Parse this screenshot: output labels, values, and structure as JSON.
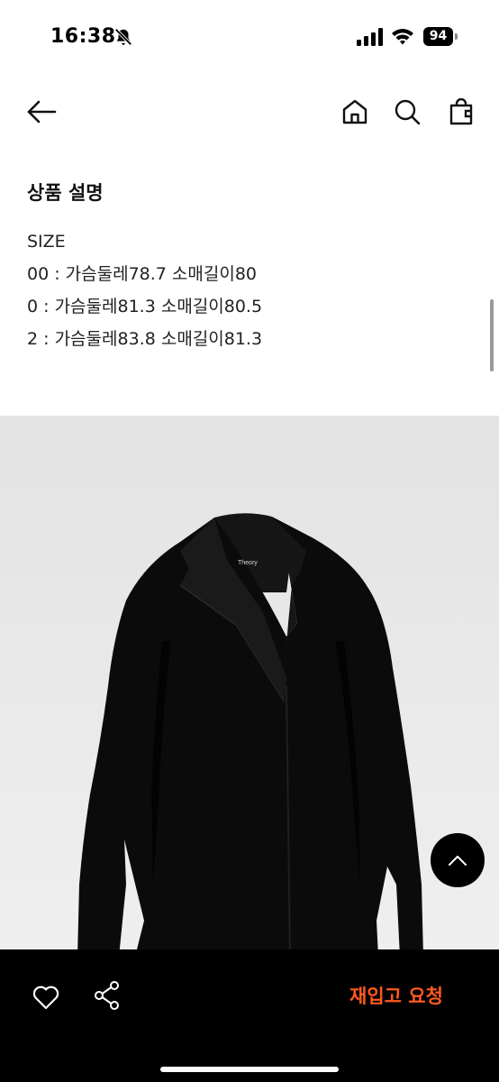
{
  "status_bar": {
    "time": "16:38",
    "battery": "94"
  },
  "header": {
    "back_icon": "arrow-left-icon",
    "home_icon": "home-icon",
    "search_icon": "search-icon",
    "bag_icon": "shopping-bag-icon"
  },
  "description": {
    "title": "상품 설명",
    "lines": [
      "SIZE",
      "00 : 가슴둘레78.7 소매길이80",
      "0 : 가슴둘레81.3 소매길이80.5",
      "2 : 가슴둘레83.8 소매길이81.3"
    ]
  },
  "product_image": {
    "label": "Theory",
    "subject": "black wool coat"
  },
  "bottom_bar": {
    "like_icon": "heart-icon",
    "share_icon": "share-icon",
    "restock_label": "재입고 요청"
  },
  "colors": {
    "accent": "#ff5a1f",
    "bar_background": "#000000",
    "coat": "#0b0b0b",
    "page_background": "#ffffff"
  }
}
